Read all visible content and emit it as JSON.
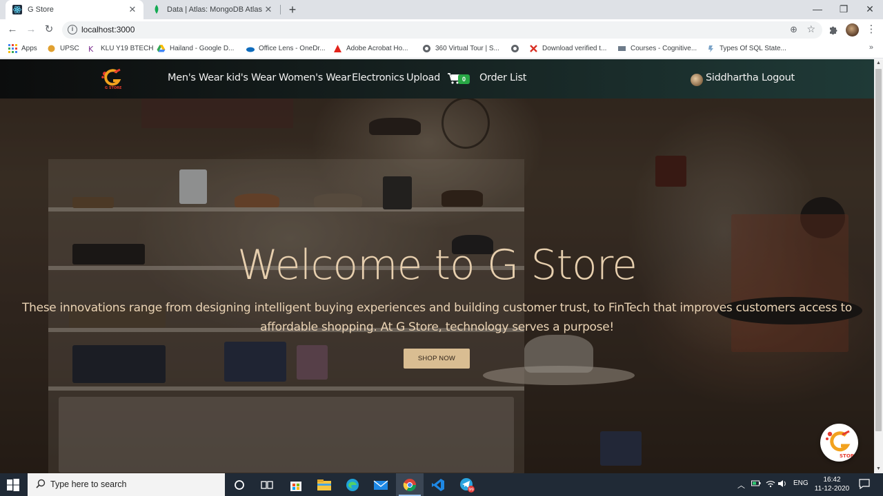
{
  "browser": {
    "tabs": [
      {
        "title": "G Store",
        "active": true,
        "icon": "react-icon"
      },
      {
        "title": "Data | Atlas: MongoDB Atlas",
        "active": false,
        "icon": "mongodb-leaf-icon"
      }
    ],
    "url": "localhost:3000",
    "bookmarks": [
      {
        "label": "Apps",
        "icon": "apps-grid-icon"
      },
      {
        "label": "UPSC",
        "icon": "emblem-icon"
      },
      {
        "label": "KLU Y19 BTECH",
        "icon": "klu-icon"
      },
      {
        "label": "Hailand - Google D...",
        "icon": "google-drive-icon"
      },
      {
        "label": "Office Lens - OneDr...",
        "icon": "onedrive-icon"
      },
      {
        "label": "Adobe Acrobat Ho...",
        "icon": "acrobat-icon"
      },
      {
        "label": "360 Virtual Tour | S...",
        "icon": "globe-icon"
      },
      {
        "label": "",
        "icon": "globe-icon"
      },
      {
        "label": "Download verified t...",
        "icon": "x-icon"
      },
      {
        "label": "Courses - Cognitive...",
        "icon": "courses-icon"
      },
      {
        "label": "Types Of SQL State...",
        "icon": "sql-icon"
      }
    ]
  },
  "navbar": {
    "brand_text": "G STORE",
    "links": [
      "Men's Wear",
      "kid's Wear",
      "Women's Wear",
      "Electronics",
      "Upload"
    ],
    "cart_count": "0",
    "order_list": "Order List",
    "username": "Siddhartha",
    "logout": "Logout"
  },
  "hero": {
    "title": "Welcome to G Store",
    "text": "These innovations range from designing intelligent buying experiences and building customer trust, to FinTech that improves customers access to affordable shopping. At G Store, technology serves a purpose!",
    "button": "SHOP NOW"
  },
  "taskbar": {
    "search_placeholder": "Type here to search",
    "language": "ENG",
    "time": "16:42",
    "date": "11-12-2020",
    "telegram_badge": "99"
  },
  "colors": {
    "accent": "#d9bd92",
    "hero_text": "#e7cfae",
    "badge": "#28a745",
    "navbar_end": "#1f3a37"
  }
}
